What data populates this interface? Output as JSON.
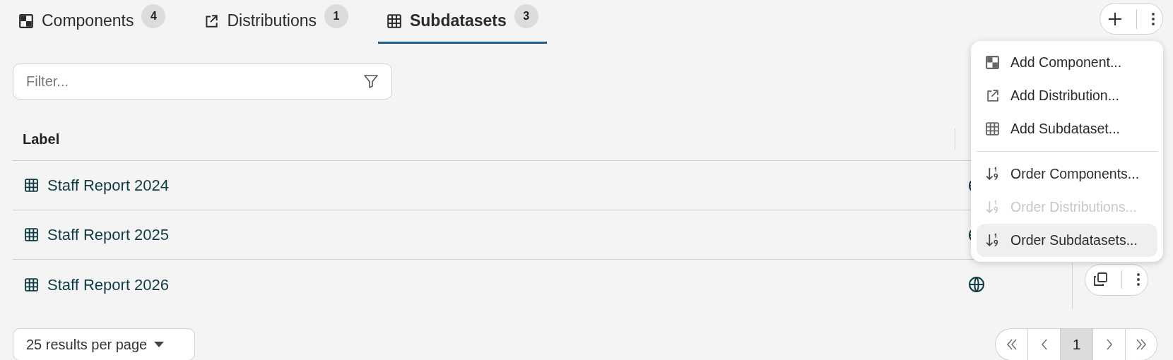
{
  "tabs": [
    {
      "kind": "component",
      "label": "Components",
      "count": "4",
      "selected": false
    },
    {
      "kind": "distribution",
      "label": "Distributions",
      "count": "1",
      "selected": false
    },
    {
      "kind": "subdataset",
      "label": "Subdatasets",
      "count": "3",
      "selected": true
    }
  ],
  "filter": {
    "placeholder": "Filter..."
  },
  "table": {
    "columns": [
      "Label"
    ],
    "rows": [
      {
        "label": "Staff Report 2024"
      },
      {
        "label": "Staff Report 2025"
      },
      {
        "label": "Staff Report 2026"
      }
    ]
  },
  "menu": [
    {
      "kind": "component",
      "label": "Add Component...",
      "disabled": false,
      "selected": false
    },
    {
      "kind": "distribution",
      "label": "Add Distribution...",
      "disabled": false,
      "selected": false
    },
    {
      "kind": "subdataset",
      "label": "Add Subdataset...",
      "disabled": false,
      "selected": false
    },
    {
      "kind": "divider"
    },
    {
      "kind": "order",
      "label": "Order Components...",
      "disabled": false,
      "selected": false
    },
    {
      "kind": "order",
      "label": "Order Distributions...",
      "disabled": true,
      "selected": false
    },
    {
      "kind": "order",
      "label": "Order Subdatasets...",
      "disabled": false,
      "selected": true
    }
  ],
  "per_page": "25 results per page",
  "pagination": [
    {
      "kind": "first",
      "selected": false
    },
    {
      "kind": "prev",
      "selected": false
    },
    {
      "kind": "page",
      "label": "1",
      "selected": true
    },
    {
      "kind": "next",
      "selected": false
    },
    {
      "kind": "last",
      "selected": false
    }
  ]
}
